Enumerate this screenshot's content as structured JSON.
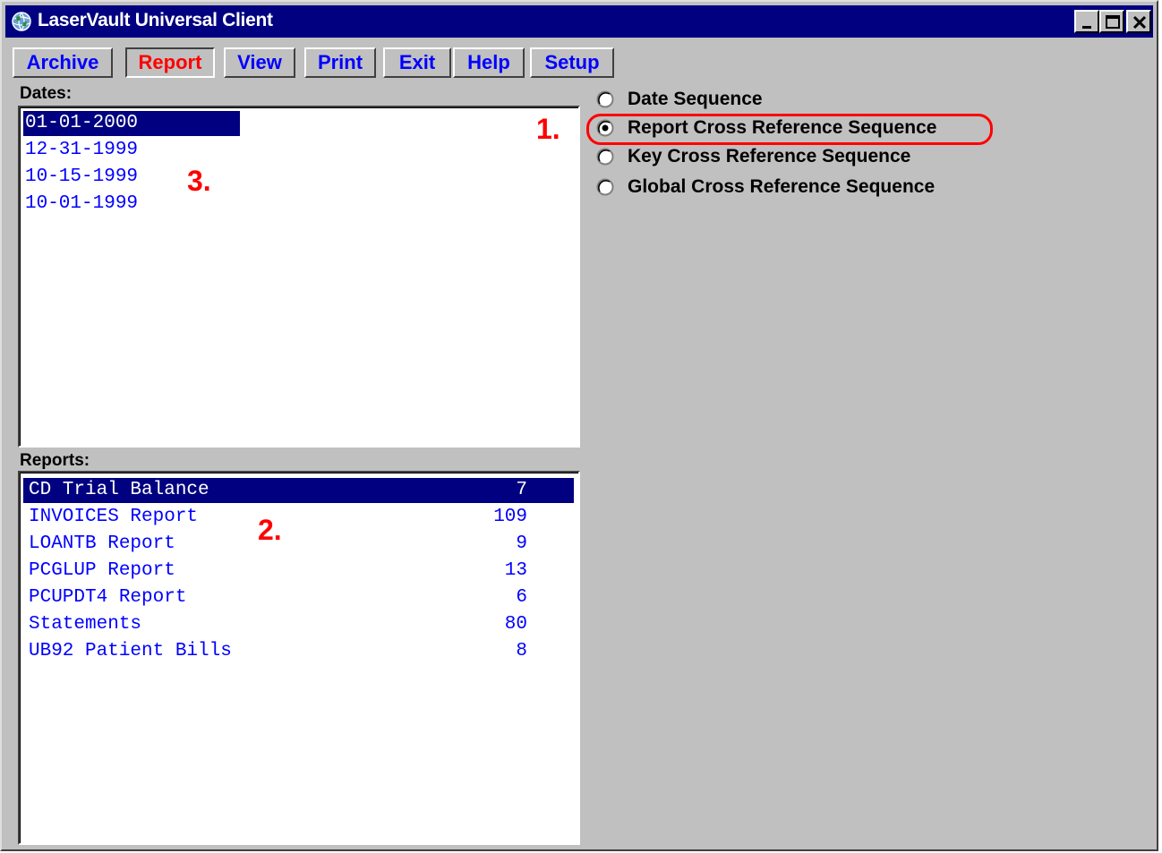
{
  "window": {
    "title": "LaserVault Universal Client"
  },
  "menu": {
    "tabs": [
      {
        "label": "Archive"
      },
      {
        "label": "Report"
      },
      {
        "label": "View"
      },
      {
        "label": "Print"
      },
      {
        "label": "Exit"
      },
      {
        "label": "Help"
      },
      {
        "label": "Setup"
      }
    ],
    "active": "Report"
  },
  "dates": {
    "label": "Dates:",
    "items": [
      "01-01-2000",
      "12-31-1999",
      "10-15-1999",
      "10-01-1999"
    ],
    "selected": "01-01-2000"
  },
  "reports": {
    "label": "Reports:",
    "items": [
      {
        "name": "CD Trial Balance",
        "count": "7"
      },
      {
        "name": "INVOICES Report",
        "count": "109"
      },
      {
        "name": "LOANTB Report",
        "count": "9"
      },
      {
        "name": "PCGLUP Report",
        "count": "13"
      },
      {
        "name": "PCUPDT4 Report",
        "count": "6"
      },
      {
        "name": "Statements",
        "count": "80"
      },
      {
        "name": "UB92 Patient Bills",
        "count": "8"
      }
    ],
    "selected": "CD Trial Balance"
  },
  "sequence": {
    "options": [
      {
        "label": "Date Sequence"
      },
      {
        "label": "Report Cross Reference Sequence"
      },
      {
        "label": "Key Cross Reference Sequence"
      },
      {
        "label": "Global Cross Reference Sequence"
      }
    ],
    "selected": "Report Cross Reference Sequence"
  },
  "annotations": [
    "1.",
    "2.",
    "3."
  ],
  "colors": {
    "title_bar": "#000080",
    "selection": "#000080",
    "list_text": "#0000ff",
    "active_tab": "#ff0000",
    "annotation": "#ff0000",
    "face": "#c0c0c0"
  },
  "icons": [
    "globe-app-icon",
    "minimize-icon",
    "maximize-icon",
    "close-icon"
  ]
}
